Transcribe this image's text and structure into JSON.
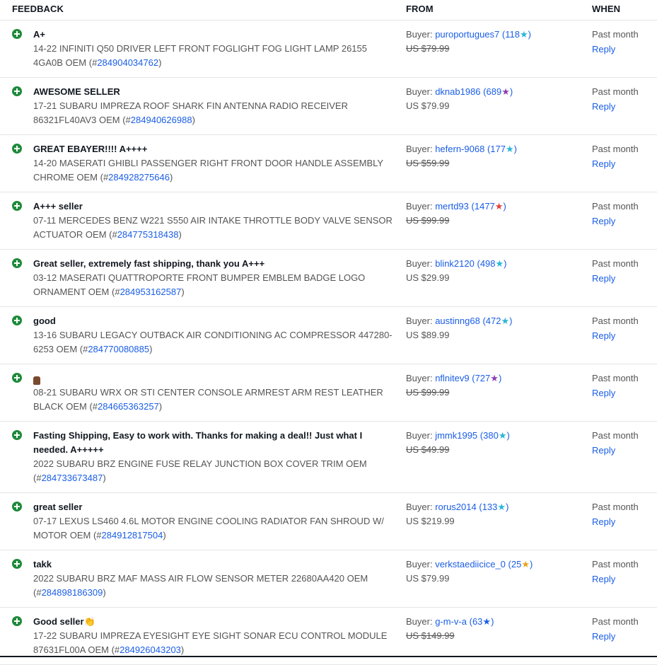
{
  "header": {
    "feedback": "FEEDBACK",
    "from": "FROM",
    "when": "WHEN"
  },
  "rows": [
    {
      "comment": "A+",
      "item": "14-22 INFINITI Q50 DRIVER LEFT FRONT FOGLIGHT FOG LIGHT LAMP 26155 4GA0B OEM (#",
      "item_id": "284904034762",
      "item_end": ")",
      "buyer_prefix": "Buyer: ",
      "buyer": "puroportugues7",
      "score": "118",
      "star": "★",
      "star_color": "#29b6d8",
      "price": "US $79.99",
      "price_strike": true,
      "when": "Past month",
      "reply": "Reply"
    },
    {
      "comment": "AWESOME SELLER",
      "item": "17-21 SUBARU IMPREZA ROOF SHARK FIN ANTENNA RADIO RECEIVER 86321FL40AV3 OEM (#",
      "item_id": "284940626988",
      "item_end": ")",
      "buyer_prefix": "Buyer: ",
      "buyer": "dknab1986",
      "score": "689",
      "star": "★",
      "star_color": "#8b3fb5",
      "price": "US $79.99",
      "price_strike": false,
      "when": "Past month",
      "reply": "Reply"
    },
    {
      "comment": "GREAT EBAYER!!!! A++++",
      "item": "14-20 MASERATI GHIBLI PASSENGER RIGHT FRONT DOOR HANDLE ASSEMBLY CHROME OEM (#",
      "item_id": "284928275646",
      "item_end": ")",
      "buyer_prefix": "Buyer: ",
      "buyer": "hefern-9068",
      "score": "177",
      "star": "★",
      "star_color": "#29b6d8",
      "price": "US $59.99",
      "price_strike": true,
      "when": "Past month",
      "reply": "Reply"
    },
    {
      "comment": "A+++ seller",
      "item": "07-11 MERCEDES BENZ W221 S550 AIR INTAKE THROTTLE BODY VALVE SENSOR ACTUATOR OEM (#",
      "item_id": "284775318438",
      "item_end": ")",
      "buyer_prefix": "Buyer: ",
      "buyer": "mertd93",
      "score": "1477",
      "star": "★",
      "star_color": "#e0403a",
      "price": "US $99.99",
      "price_strike": true,
      "when": "Past month",
      "reply": "Reply"
    },
    {
      "comment": "Great seller, extremely fast shipping, thank you A+++",
      "item": "03-12 MASERATI QUATTROPORTE FRONT BUMPER EMBLEM BADGE LOGO ORNAMENT OEM (#",
      "item_id": "284953162587",
      "item_end": ")",
      "buyer_prefix": "Buyer: ",
      "buyer": "blink2120",
      "score": "498",
      "star": "★",
      "star_color": "#29b6d8",
      "price": "US $29.99",
      "price_strike": false,
      "when": "Past month",
      "reply": "Reply"
    },
    {
      "comment": "good",
      "item": "13-16 SUBARU LEGACY OUTBACK AIR CONDITIONING AC COMPRESSOR 447280-6253 OEM (#",
      "item_id": "284770080885",
      "item_end": ")",
      "buyer_prefix": "Buyer: ",
      "buyer": "austinng68",
      "score": "472",
      "star": "★",
      "star_color": "#29b6d8",
      "price": "US $89.99",
      "price_strike": false,
      "when": "Past month",
      "reply": "Reply"
    },
    {
      "comment": "",
      "thumb": true,
      "item": "08-21 SUBARU WRX OR STI CENTER CONSOLE ARMREST ARM REST LEATHER BLACK OEM (#",
      "item_id": "284665363257",
      "item_end": ")",
      "buyer_prefix": "Buyer: ",
      "buyer": "nflnitev9",
      "score": "727",
      "star": "★",
      "star_color": "#8b3fb5",
      "price": "US $99.99",
      "price_strike": true,
      "when": "Past month",
      "reply": "Reply"
    },
    {
      "comment": "Fasting Shipping, Easy to work with. Thanks for making a deal!! Just what I needed. A+++++",
      "item": "2022 SUBARU BRZ ENGINE FUSE RELAY JUNCTION BOX COVER TRIM OEM (#",
      "item_id": "284733673487",
      "item_end": ")",
      "buyer_prefix": "Buyer: ",
      "buyer": "jmmk1995",
      "score": "380",
      "star": "★",
      "star_color": "#29b6d8",
      "price": "US $49.99",
      "price_strike": true,
      "when": "Past month",
      "reply": "Reply",
      "tall": true
    },
    {
      "comment": "great seller",
      "item": "07-17 LEXUS LS460 4.6L MOTOR ENGINE COOLING RADIATOR FAN SHROUD W/ MOTOR OEM (#",
      "item_id": "284912817504",
      "item_end": ")",
      "buyer_prefix": "Buyer: ",
      "buyer": "rorus2014",
      "score": "133",
      "star": "★",
      "star_color": "#29b6d8",
      "price": "US $219.99",
      "price_strike": false,
      "when": "Past month",
      "reply": "Reply"
    },
    {
      "comment": "takk",
      "item": "2022 SUBARU BRZ MAF MASS AIR FLOW SENSOR METER 22680AA420 OEM (#",
      "item_id": "284898186309",
      "item_end": ")",
      "buyer_prefix": "Buyer: ",
      "buyer": "verkstaediicice_0",
      "score": "25",
      "star": "★",
      "star_color": "#e8a31a",
      "price": "US $79.99",
      "price_strike": false,
      "when": "Past month",
      "reply": "Reply"
    },
    {
      "comment": "Good seller👏",
      "item": "17-22 SUBARU IMPREZA EYESIGHT EYE SIGHT SONAR ECU CONTROL MODULE 87631FL00A OEM (#",
      "item_id": "284926043203",
      "item_end": ")",
      "buyer_prefix": "Buyer: ",
      "buyer": "g-m-v-a",
      "score": "63",
      "star": "★",
      "star_color": "#1a5ee6",
      "price": "US $149.99",
      "price_strike": true,
      "when": "Past month",
      "reply": "Reply"
    }
  ]
}
